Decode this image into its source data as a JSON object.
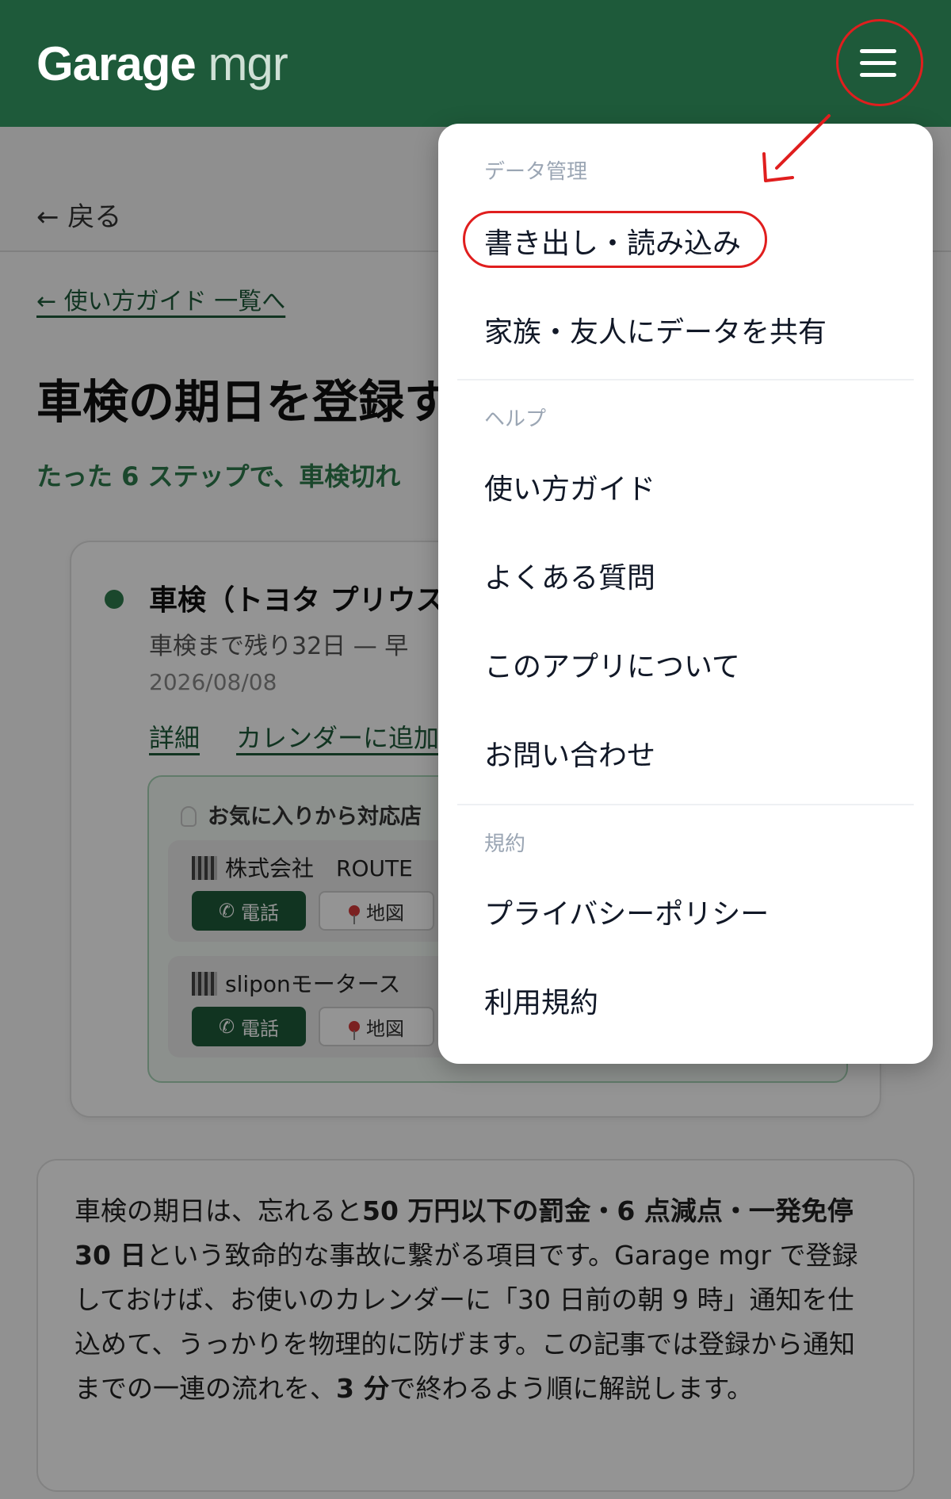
{
  "app": {
    "logo_main": "Garage",
    "logo_sub": " mgr",
    "menu_button_label": ""
  },
  "page": {
    "back_label": "← 戻る",
    "guide_link": "← 使い方ガイド 一覧へ",
    "title": "車検の期日を登録す",
    "subtitle": "たった 6 ステップで、車検切れ"
  },
  "card": {
    "title": "車検（トヨタ プリウス",
    "status": "車検まで残り32日 — 早",
    "date": "2026/08/08",
    "links": [
      "詳細",
      "カレンダーに追加"
    ],
    "favorites_heading": "お気に入りから対応店",
    "shops": [
      {
        "name": "株式会社　ROUTE",
        "call_label": "電話",
        "map_label": "地図"
      },
      {
        "name": "sliponモータース",
        "call_label": "電話",
        "map_label": "地図"
      }
    ]
  },
  "intro": {
    "p1": "車検の期日は、忘れると",
    "b1": "50 万円以下の罰金・6 点減点・一発免停 30 日",
    "p2": "という致命的な事故に繋がる項目です。Garage mgr で登録しておけば、お使いのカレンダーに「30 日前の朝 9 時」通知を仕込めて、うっかりを物理的に防げます。この記事では登録から通知までの一連の流れを、",
    "b2": "3 分",
    "p3": "で終わるよう順に解説します。"
  },
  "menu": {
    "sections": [
      {
        "label": "データ管理",
        "items": [
          "書き出し・読み込み",
          "家族・友人にデータを共有"
        ]
      },
      {
        "label": "ヘルプ",
        "items": [
          "使い方ガイド",
          "よくある質問",
          "このアプリについて",
          "お問い合わせ"
        ]
      },
      {
        "label": "規約",
        "items": [
          "プライバシーポリシー",
          "利用規約"
        ]
      }
    ]
  },
  "colors": {
    "header": "#1e5a3a",
    "accent_green": "#2e7a4c",
    "annotation_red": "#e01e1e"
  }
}
